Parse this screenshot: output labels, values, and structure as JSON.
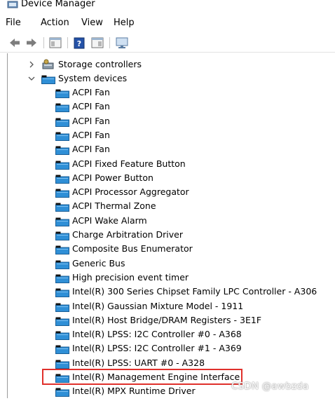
{
  "window": {
    "title": "Device Manager"
  },
  "menu": {
    "file": "File",
    "action": "Action",
    "view": "View",
    "help": "Help"
  },
  "tree": {
    "storage_controllers": "Storage controllers",
    "system_devices": "System devices",
    "children": [
      "ACPI Fan",
      "ACPI Fan",
      "ACPI Fan",
      "ACPI Fan",
      "ACPI Fan",
      "ACPI Fixed Feature Button",
      "ACPI Power Button",
      "ACPI Processor Aggregator",
      "ACPI Thermal Zone",
      "ACPI Wake Alarm",
      "Charge Arbitration Driver",
      "Composite Bus Enumerator",
      "Generic Bus",
      "High precision event timer",
      "Intel(R) 300 Series Chipset Family LPC Controller - A306",
      "Intel(R) Gaussian Mixture Model - 1911",
      "Intel(R) Host Bridge/DRAM Registers - 3E1F",
      "Intel(R) LPSS: I2C Controller #0 - A368",
      "Intel(R) LPSS: I2C Controller #1 - A369",
      "Intel(R) LPSS: UART #0 - A328",
      "Intel(R) Management Engine Interface",
      "Intel(R) MPX Runtime Driver"
    ]
  },
  "watermark": "CSDN @awbzda",
  "colors": {
    "highlight_border": "#e0302b",
    "folder_blue": "#2f8fd6"
  }
}
